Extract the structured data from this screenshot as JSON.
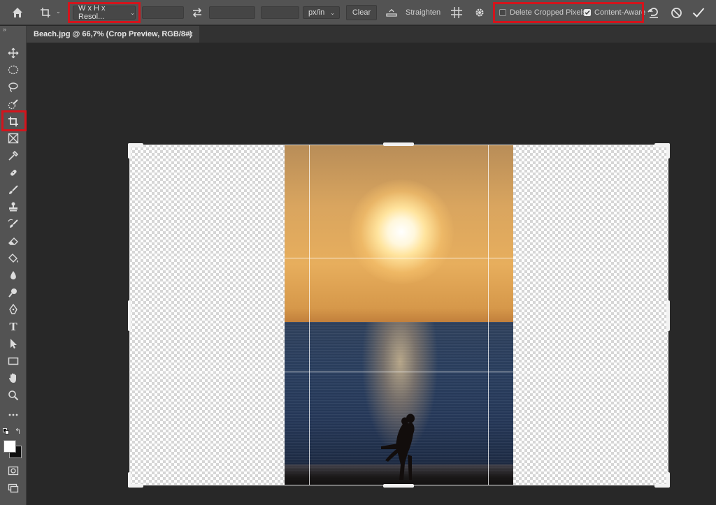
{
  "options_bar": {
    "home_icon": "home-icon",
    "tool_icon": "crop-tool-icon",
    "ratio_preset": "W x H x Resol...",
    "swap_icon": "swap-arrows-icon",
    "units": "px/in",
    "clear_label": "Clear",
    "straighten_icon": "level-icon",
    "straighten_label": "Straighten",
    "overlay_icon": "grid-overlay-icon",
    "settings_icon": "gear-icon",
    "delete_cropped_label": "Delete Cropped Pixels",
    "delete_cropped_checked": false,
    "content_aware_label": "Content-Aware",
    "content_aware_checked": true,
    "reset_icon": "reset-icon",
    "cancel_icon": "cancel-icon",
    "commit_icon": "checkmark-icon"
  },
  "document_tab": {
    "title": "Beach.jpg @ 66,7% (Crop Preview, RGB/8#)",
    "close": "×"
  },
  "toolbar": {
    "collapse": "»",
    "tools": [
      "move-icon",
      "marquee-icon",
      "lasso-icon",
      "quick-selection-icon",
      "crop-icon",
      "frame-icon",
      "eyedropper-icon",
      "healing-brush-icon",
      "brush-icon",
      "clone-stamp-icon",
      "history-brush-icon",
      "eraser-icon",
      "paint-bucket-icon",
      "blur-icon",
      "dodge-icon",
      "pen-icon",
      "type-icon",
      "path-selection-icon",
      "rectangle-icon",
      "hand-icon",
      "zoom-icon",
      "more-tools-icon",
      "default-colors-icon",
      "swap-colors-icon",
      "color-swatches-icon",
      "quick-mask-icon",
      "screen-mode-icon"
    ],
    "active_tool": "crop-icon",
    "type_glyph": "T"
  },
  "colors": {
    "highlight": "#d4141c",
    "panel": "#535353",
    "canvas": "#282828"
  }
}
